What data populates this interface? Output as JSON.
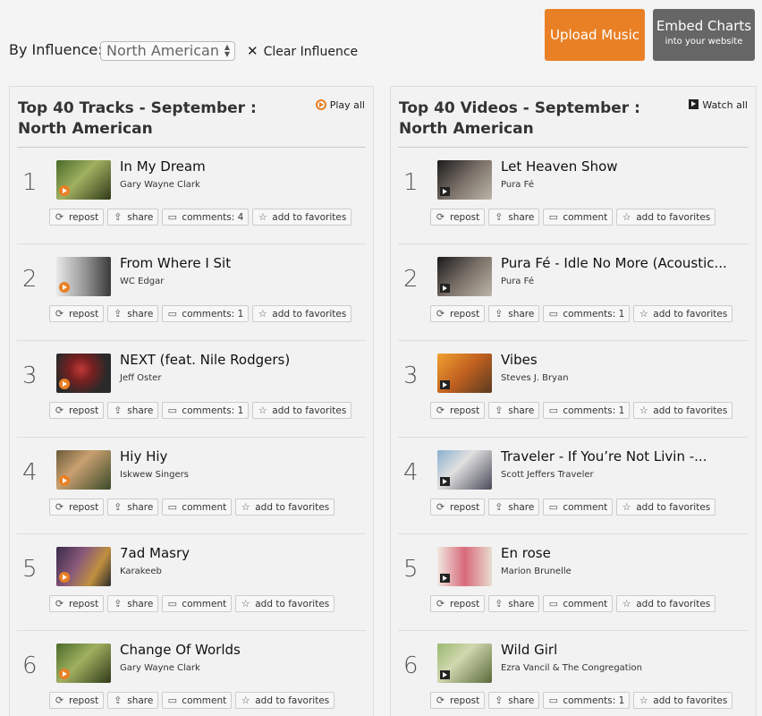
{
  "influence": {
    "label": "By Influence:",
    "selected": "North American",
    "clear_label": "Clear Influence"
  },
  "buttons": {
    "upload": "Upload Music",
    "embed_main": "Embed Charts",
    "embed_sub": "into your website"
  },
  "tracks_panel": {
    "title": "Top 40 Tracks - September : North American",
    "action": "Play all",
    "rows": [
      {
        "rank": "1",
        "title": "In My Dream",
        "artist": "Gary Wayne Clark",
        "comments": "comments: 4"
      },
      {
        "rank": "2",
        "title": "From Where I Sit",
        "artist": "WC Edgar",
        "comments": "comments: 1"
      },
      {
        "rank": "3",
        "title": "NEXT (feat. Nile Rodgers)",
        "artist": "Jeff Oster",
        "comments": "comments: 1"
      },
      {
        "rank": "4",
        "title": "Hiy Hiy",
        "artist": "Iskwew Singers",
        "comments": "comment"
      },
      {
        "rank": "5",
        "title": "7ad Masry",
        "artist": "Karakeeb",
        "comments": "comment"
      },
      {
        "rank": "6",
        "title": "Change Of Worlds",
        "artist": "Gary Wayne Clark",
        "comments": "comment"
      }
    ]
  },
  "videos_panel": {
    "title": "Top 40 Videos - September : North American",
    "action": "Watch all",
    "rows": [
      {
        "rank": "1",
        "title": "Let Heaven Show",
        "artist": "Pura Fé",
        "comments": "comment"
      },
      {
        "rank": "2",
        "title": "Pura Fé - Idle No More (Acoustic...",
        "artist": "Pura Fé",
        "comments": "comments: 1"
      },
      {
        "rank": "3",
        "title": "Vibes",
        "artist": "Steves J. Bryan",
        "comments": "comments: 1"
      },
      {
        "rank": "4",
        "title": "Traveler - If You’re Not Livin -...",
        "artist": "Scott Jeffers Traveler",
        "comments": "comment"
      },
      {
        "rank": "5",
        "title": "En rose",
        "artist": "Marion Brunelle",
        "comments": "comment"
      },
      {
        "rank": "6",
        "title": "Wild Girl",
        "artist": "Ezra Vancil & The Congregation",
        "comments": "comments: 1"
      }
    ]
  },
  "action_labels": {
    "repost": "repost",
    "share": "share",
    "favorites": "add to favorites"
  },
  "colors": {
    "accent": "#e98025",
    "embed_bg": "#666666"
  }
}
